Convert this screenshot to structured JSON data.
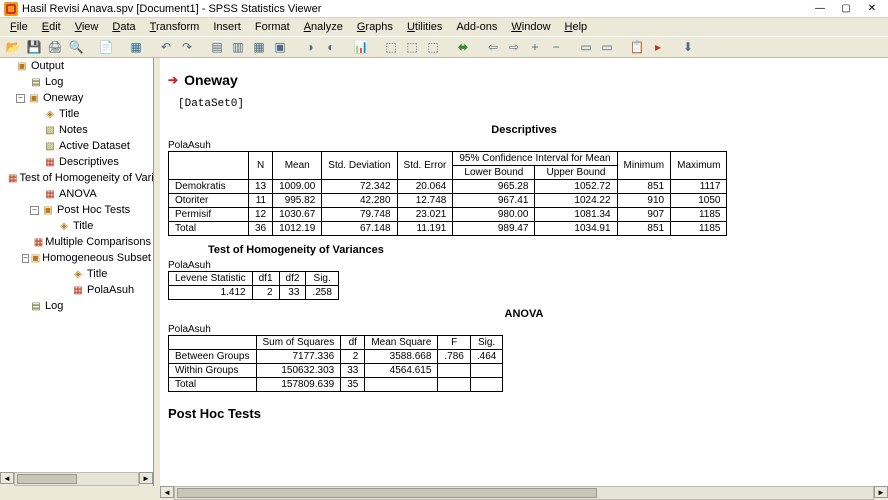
{
  "window": {
    "title": "Hasil Revisi Anava.spv [Document1] - SPSS Statistics Viewer"
  },
  "menu": {
    "file": "File",
    "edit": "Edit",
    "view": "View",
    "data": "Data",
    "transform": "Transform",
    "insert": "Insert",
    "format": "Format",
    "analyze": "Analyze",
    "graphs": "Graphs",
    "utilities": "Utilities",
    "addons": "Add-ons",
    "window": "Window",
    "help": "Help"
  },
  "tree": {
    "root": "Output",
    "log1": "Log",
    "oneway": "Oneway",
    "title1": "Title",
    "notes": "Notes",
    "activedataset": "Active Dataset",
    "descriptives": "Descriptives",
    "tohv": "Test of Homogeneity of Vari",
    "anova": "ANOVA",
    "posthoc": "Post Hoc Tests",
    "title2": "Title",
    "multcomp": "Multiple Comparisons",
    "homsub": "Homogeneous Subset",
    "title3": "Title",
    "polaasuht": "PolaAsuh",
    "log2": "Log"
  },
  "doc": {
    "section": "Oneway",
    "dataset": "[DataSet0]",
    "desc_title": "Descriptives",
    "varname": "PolaAsuh",
    "desc_headers": {
      "n": "N",
      "mean": "Mean",
      "std": "Std. Deviation",
      "se": "Std. Error",
      "ci": "95% Confidence Interval for Mean",
      "lb": "Lower Bound",
      "ub": "Upper Bound",
      "min": "Minimum",
      "max": "Maximum"
    },
    "desc_rows": [
      {
        "g": "Demokratis",
        "n": "13",
        "mean": "1009.00",
        "std": "72.342",
        "se": "20.064",
        "lb": "965.28",
        "ub": "1052.72",
        "min": "851",
        "max": "1117"
      },
      {
        "g": "Otoriter",
        "n": "11",
        "mean": "995.82",
        "std": "42.280",
        "se": "12.748",
        "lb": "967.41",
        "ub": "1024.22",
        "min": "910",
        "max": "1050"
      },
      {
        "g": "Permisif",
        "n": "12",
        "mean": "1030.67",
        "std": "79.748",
        "se": "23.021",
        "lb": "980.00",
        "ub": "1081.34",
        "min": "907",
        "max": "1185"
      },
      {
        "g": "Total",
        "n": "36",
        "mean": "1012.19",
        "std": "67.148",
        "se": "11.191",
        "lb": "989.47",
        "ub": "1034.91",
        "min": "851",
        "max": "1185"
      }
    ],
    "hov_title": "Test of Homogeneity of Variances",
    "hov_headers": {
      "lev": "Levene Statistic",
      "df1": "df1",
      "df2": "df2",
      "sig": "Sig."
    },
    "hov_row": {
      "lev": "1.412",
      "df1": "2",
      "df2": "33",
      "sig": ".258"
    },
    "anova_title": "ANOVA",
    "anova_headers": {
      "ss": "Sum of Squares",
      "df": "df",
      "ms": "Mean Square",
      "f": "F",
      "sig": "Sig."
    },
    "anova_rows": [
      {
        "g": "Between Groups",
        "ss": "7177.336",
        "df": "2",
        "ms": "3588.668",
        "f": ".786",
        "sig": ".464"
      },
      {
        "g": "Within Groups",
        "ss": "150632.303",
        "df": "33",
        "ms": "4564.615",
        "f": "",
        "sig": ""
      },
      {
        "g": "Total",
        "ss": "157809.639",
        "df": "35",
        "ms": "",
        "f": "",
        "sig": ""
      }
    ],
    "posthoc": "Post Hoc Tests"
  }
}
